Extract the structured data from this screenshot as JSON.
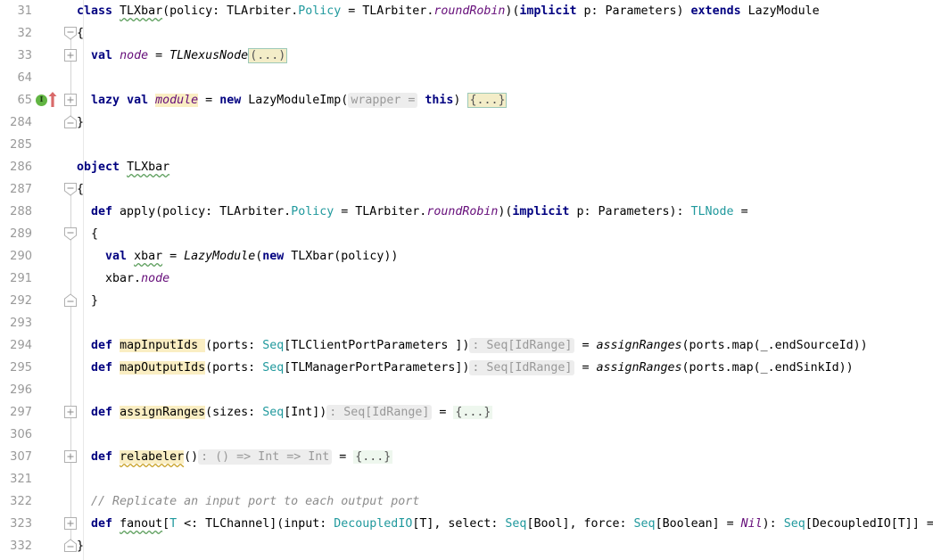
{
  "editor": {
    "language": "Scala",
    "colors": {
      "keyword": "#000080",
      "type": "#20999d",
      "italic_purple": "#660e7a",
      "comment": "#8c8c8c",
      "hint_text": "#999999",
      "hint_bg": "#ededed",
      "identifier_highlight_bg": "#faeec3",
      "fold_placeholder_bg": "#f3edc8",
      "fold_placeholder_border": "#9dc9b8",
      "gutter_text": "#999999",
      "implemented_marker": "#62b543",
      "override_arrow": "#d96a6a"
    },
    "gutter_icons": {
      "implemented_label": "I",
      "override_arrow_name": "overridden-method-arrow"
    },
    "fold_placeholder_paren": "(...)",
    "fold_placeholder_brace": "{...}",
    "lines": [
      {
        "num": "31",
        "fold": "none",
        "rail": "none"
      },
      {
        "num": "32",
        "fold": "collapse-top",
        "rail": "bottom"
      },
      {
        "num": "33",
        "fold": "expand",
        "rail": "both"
      },
      {
        "num": "64",
        "fold": "none",
        "rail": "both"
      },
      {
        "num": "65",
        "fold": "expand",
        "rail": "both",
        "icon": "implemented-override"
      },
      {
        "num": "284",
        "fold": "collapse-bot",
        "rail": "top"
      },
      {
        "num": "285",
        "fold": "none",
        "rail": "none"
      },
      {
        "num": "286",
        "fold": "none",
        "rail": "none"
      },
      {
        "num": "287",
        "fold": "collapse-top",
        "rail": "bottom"
      },
      {
        "num": "288",
        "fold": "none",
        "rail": "both"
      },
      {
        "num": "289",
        "fold": "collapse-top",
        "rail": "both"
      },
      {
        "num": "290",
        "fold": "none",
        "rail": "both"
      },
      {
        "num": "291",
        "fold": "none",
        "rail": "both"
      },
      {
        "num": "292",
        "fold": "collapse-bot",
        "rail": "both"
      },
      {
        "num": "293",
        "fold": "none",
        "rail": "both"
      },
      {
        "num": "294",
        "fold": "none",
        "rail": "both"
      },
      {
        "num": "295",
        "fold": "none",
        "rail": "both"
      },
      {
        "num": "296",
        "fold": "none",
        "rail": "both"
      },
      {
        "num": "297",
        "fold": "expand",
        "rail": "both"
      },
      {
        "num": "306",
        "fold": "none",
        "rail": "both"
      },
      {
        "num": "307",
        "fold": "expand",
        "rail": "both"
      },
      {
        "num": "321",
        "fold": "none",
        "rail": "both"
      },
      {
        "num": "322",
        "fold": "none",
        "rail": "both"
      },
      {
        "num": "323",
        "fold": "expand",
        "rail": "both"
      },
      {
        "num": "332",
        "fold": "collapse-bot",
        "rail": "top"
      }
    ],
    "code": {
      "l31": "class TLXbar(policy: TLArbiter.Policy = TLArbiter.roundRobin)(implicit p: Parameters) extends LazyModule",
      "l32": "{",
      "l33": "  val node = TLNexusNode(...)",
      "l64": "",
      "l65": "  lazy val module = new LazyModuleImp( wrapper = this) {...}",
      "l284": "}",
      "l285": "",
      "l286": "object TLXbar",
      "l287": "{",
      "l288": "  def apply(policy: TLArbiter.Policy = TLArbiter.roundRobin)(implicit p: Parameters): TLNode =",
      "l289": "  {",
      "l290": "    val xbar = LazyModule(new TLXbar(policy))",
      "l291": "    xbar.node",
      "l292": "  }",
      "l293": "",
      "l294": "  def mapInputIds (ports: Seq[TLClientPortParameters ]): Seq[IdRange] = assignRanges(ports.map(_.endSourceId))",
      "l295": "  def mapOutputIds(ports: Seq[TLManagerPortParameters]): Seq[IdRange] = assignRanges(ports.map(_.endSinkId))",
      "l296": "",
      "l297": "  def assignRanges(sizes: Seq[Int]): Seq[IdRange] = {...}",
      "l306": "",
      "l307": "  def relabeler(): () => Int => Int = {...}",
      "l321": "",
      "l322": "  // Replicate an input port to each output port",
      "l323": "  def fanout[T <: TLChannel](input: DecoupledIO[T], select: Seq[Bool], force: Seq[Boolean] = Nil): Seq[DecoupledIO[T]] =",
      "l332": "}"
    },
    "tokens": {
      "kw_class": "class",
      "kw_val": "val",
      "kw_lazy": "lazy",
      "kw_new": "new",
      "kw_implicit": "implicit",
      "kw_extends": "extends",
      "kw_object": "object",
      "kw_def": "def",
      "name_TLXbar": "TLXbar",
      "name_policy": "policy",
      "name_TLArbiter": "TLArbiter",
      "name_Policy": "Policy",
      "name_roundRobin": "roundRobin",
      "name_p": "p",
      "name_Parameters": "Parameters",
      "name_LazyModule": "LazyModule",
      "name_node": "node",
      "name_TLNexusNode": "TLNexusNode",
      "name_module": "module",
      "name_LazyModuleImp": "LazyModuleImp",
      "hint_wrapper": "wrapper =",
      "kw_this": "this",
      "name_apply": "apply",
      "name_TLNode": "TLNode",
      "name_xbar": "xbar",
      "name_mapInputIds": "mapInputIds",
      "name_mapOutputIds": "mapOutputIds",
      "name_Seq": "Seq",
      "name_TLClientPortParameters": "TLClientPortParameters",
      "name_TLManagerPortParameters": "TLManagerPortParameters",
      "name_IdRange": "IdRange",
      "name_assignRanges": "assignRanges",
      "name_ports": "ports",
      "name_endSourceId": "endSourceId",
      "name_endSinkId": "endSinkId",
      "name_sizes": "sizes",
      "name_Int": "Int",
      "name_relabeler": "relabeler",
      "comment_322": "// Replicate an input port to each output port",
      "name_fanout": "fanout",
      "name_T": "T",
      "name_TLChannel": "TLChannel",
      "name_input": "input",
      "name_DecoupledIO": "DecoupledIO",
      "name_select": "select",
      "name_Bool": "Bool",
      "name_force": "force",
      "name_Boolean": "Boolean",
      "name_Nil": "Nil"
    }
  }
}
